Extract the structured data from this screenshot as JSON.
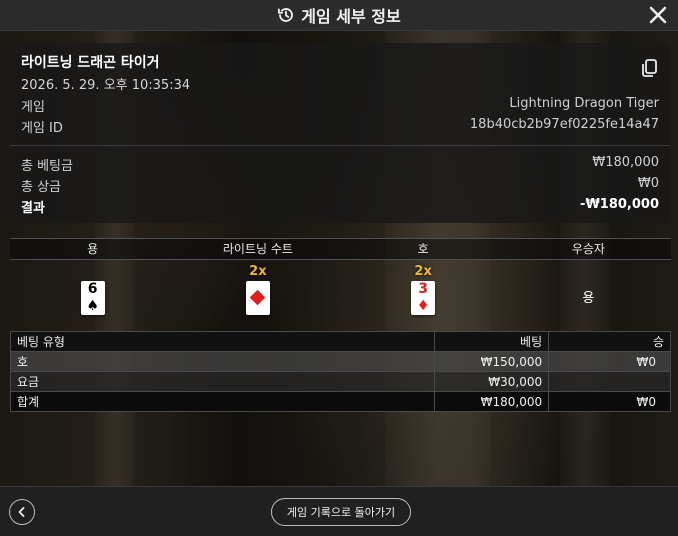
{
  "header": {
    "title": "게임 세부 정보",
    "icon": "history-icon",
    "close_icon": "close-icon"
  },
  "summary": {
    "game_name": "라이트닝 드래곤 타이거",
    "timestamp": "2026. 5. 29. 오후 10:35:34",
    "copy_icon": "copy-icon",
    "game_label": "게임",
    "game_value": "Lightning Dragon Tiger",
    "game_id_label": "게임 ID",
    "game_id_value": "18b40cb2b97ef0225fe14a47",
    "total_bet_label": "총 베팅금",
    "total_bet_value": "₩180,000",
    "total_win_label": "총 상금",
    "total_win_value": "₩0",
    "result_label": "결과",
    "result_value": "-₩180,000"
  },
  "result": {
    "headers": [
      "용",
      "라이트닝 수트",
      "호",
      "우승자"
    ],
    "dragon_card": {
      "rank": "6",
      "suit": "♠",
      "color": "#000000"
    },
    "lightning_suit": {
      "multiplier": "2x",
      "suit": "♦",
      "color": "#e02020"
    },
    "tiger_card": {
      "multiplier": "2x",
      "rank": "3",
      "suit": "♦",
      "color": "#e02020"
    },
    "winner": "용"
  },
  "bets": {
    "headers": [
      "베팅 유형",
      "베팅",
      "승"
    ],
    "rows": [
      {
        "type": "호",
        "bet": "₩150,000",
        "win": "₩0"
      },
      {
        "type": "요금",
        "bet": "₩30,000",
        "win": ""
      },
      {
        "type": "합계",
        "bet": "₩180,000",
        "win": "₩0"
      }
    ]
  },
  "footer": {
    "back_icon": "chevron-left-icon",
    "history_button": "게임 기록으로 돌아가기"
  }
}
